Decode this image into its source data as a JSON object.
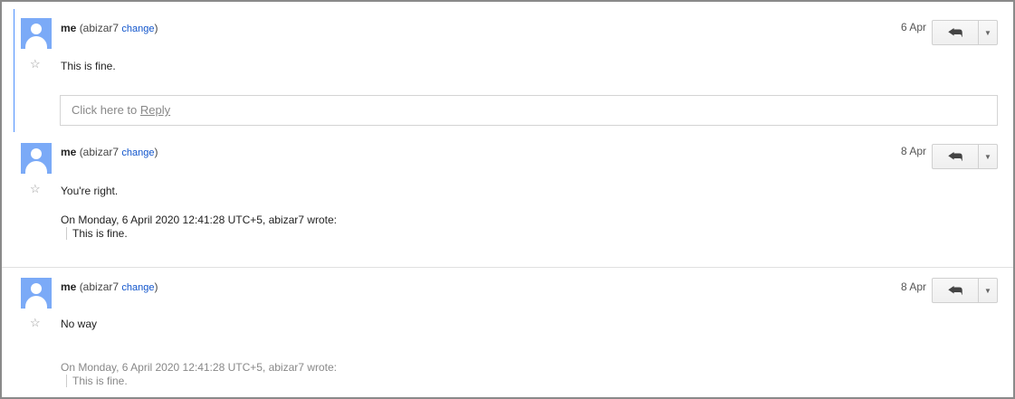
{
  "messages": [
    {
      "sender_name": "me",
      "account_prefix": "(abizar7",
      "change_label": "change",
      "account_suffix": ")",
      "date": "6 Apr",
      "star_glyph": "☆",
      "body": "This is fine.",
      "reply_placeholder_prefix": "Click here to ",
      "reply_link_label": "Reply"
    },
    {
      "sender_name": "me",
      "account_prefix": "(abizar7",
      "change_label": "change",
      "account_suffix": ")",
      "date": "8 Apr",
      "star_glyph": "☆",
      "body": "You're right.",
      "quote_header": "On Monday, 6 April 2020 12:41:28 UTC+5, abizar7 wrote:",
      "quote_text": "This is fine."
    },
    {
      "sender_name": "me",
      "account_prefix": "(abizar7",
      "change_label": "change",
      "account_suffix": ")",
      "date": "8 Apr",
      "star_glyph": "☆",
      "body": "No way",
      "quote_header": "On Monday, 6 April 2020 12:41:28 UTC+5, abizar7 wrote:",
      "quote_text": "This is fine."
    }
  ],
  "icons": {
    "reply_all": "reply-all-icon",
    "dropdown": "dropdown-arrow-icon",
    "avatar": "default-avatar-icon",
    "star": "star-icon"
  },
  "colors": {
    "avatar_bg": "#7baaf7",
    "change_link": "#1155cc",
    "focus_bar": "#4d90fe"
  }
}
